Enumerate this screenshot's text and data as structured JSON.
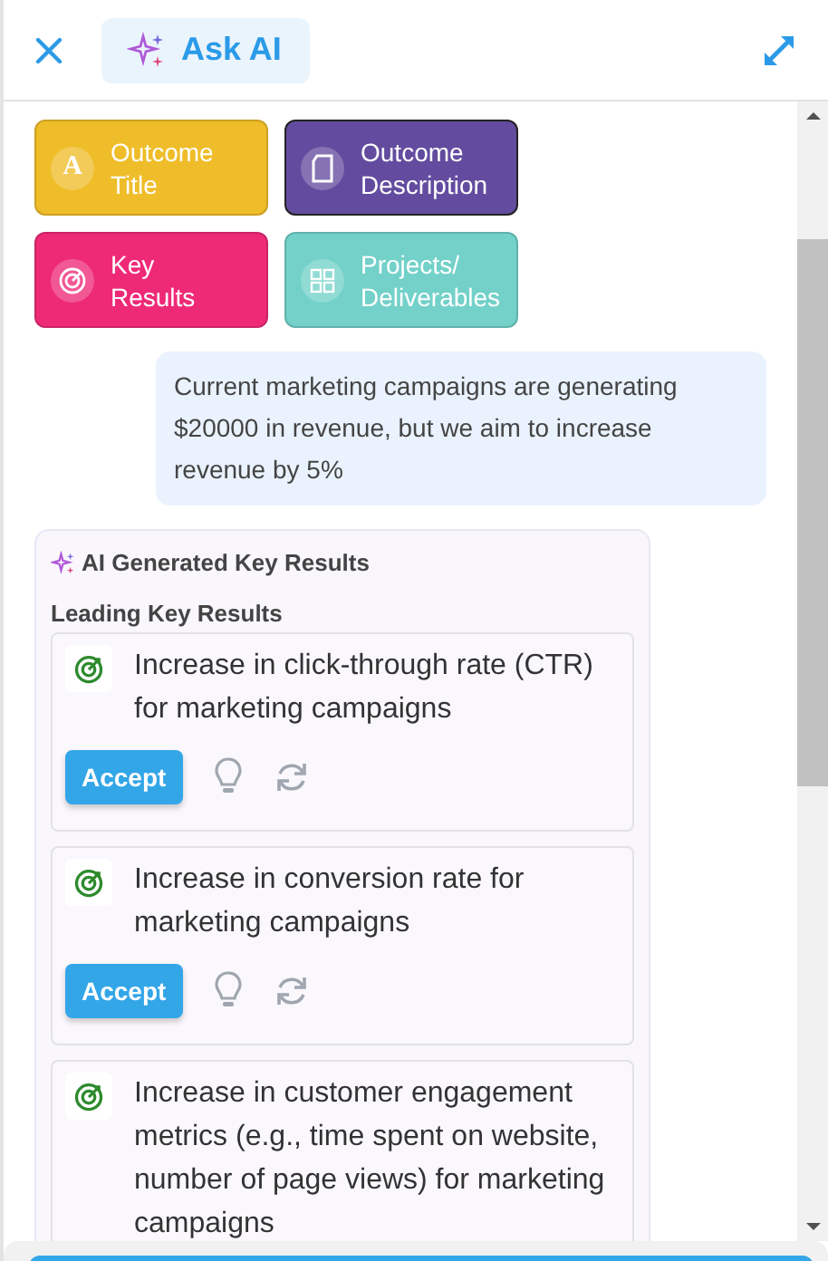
{
  "header": {
    "ask_ai_label": "Ask AI"
  },
  "chips": [
    {
      "label": "Outcome Title",
      "kind": "letter",
      "icon_text": "A",
      "color": "#efbd29"
    },
    {
      "label": "Outcome Description",
      "kind": "page",
      "color": "#634c9f"
    },
    {
      "label": "Key Results",
      "kind": "target",
      "color": "#ee2a77"
    },
    {
      "label": "Projects/ Deliverables",
      "kind": "grid",
      "color": "#73d1c9"
    }
  ],
  "user_message": "Current marketing campaigns are generating $20000 in revenue, but we aim to increase revenue by 5%",
  "ai_card": {
    "title": "AI Generated Key Results",
    "section": "Leading Key Results",
    "items": [
      {
        "text": "Increase in click-through rate (CTR) for marketing campaigns",
        "accept": "Accept"
      },
      {
        "text": "Increase in conversion rate for marketing campaigns",
        "accept": "Accept"
      },
      {
        "text": "Increase in customer engagement metrics (e.g., time spent on website, number of page views) for marketing campaigns"
      }
    ]
  }
}
